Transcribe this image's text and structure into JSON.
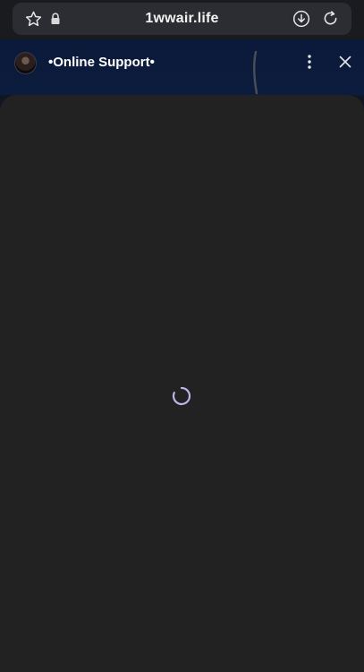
{
  "browser": {
    "url": "1wwair.life",
    "icons": {
      "favorite": "star-icon",
      "secure": "lock-icon",
      "download": "download-icon",
      "reload": "reload-icon"
    }
  },
  "chat": {
    "title": "•Online Support•",
    "icons": {
      "menu": "more-vertical-icon",
      "close": "close-icon"
    },
    "status": "loading"
  },
  "colors": {
    "header_bg": "#0c1c3e",
    "body_bg": "#222222",
    "spinner": "#b9b6e8"
  }
}
